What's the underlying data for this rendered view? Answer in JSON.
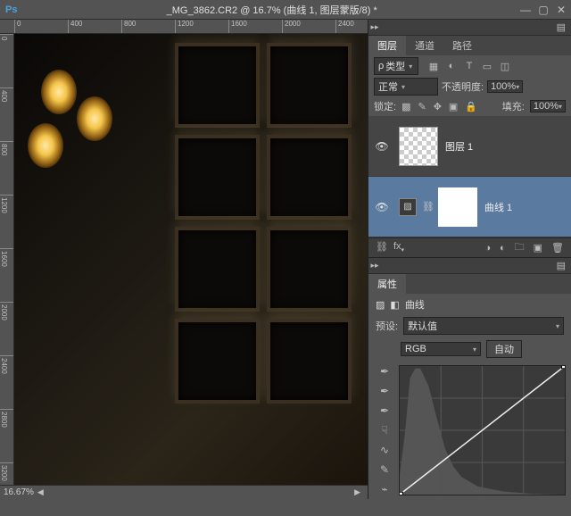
{
  "title": "_MG_3862.CR2 @ 16.7% (曲线 1, 图层蒙版/8) *",
  "ruler_h": [
    "0",
    "400",
    "800",
    "1200",
    "1600",
    "2000",
    "2400"
  ],
  "ruler_v": [
    "0",
    "400",
    "800",
    "1200",
    "1600",
    "2000",
    "2400",
    "2800",
    "3200"
  ],
  "status": {
    "zoom": "16.67%"
  },
  "layers_panel": {
    "tabs": [
      {
        "label": "图层",
        "active": true
      },
      {
        "label": "通道",
        "active": false
      },
      {
        "label": "路径",
        "active": false
      }
    ],
    "kind_label": "类型",
    "blend_mode": "正常",
    "opacity_label": "不透明度:",
    "opacity_value": "100%",
    "lock_label": "锁定:",
    "fill_label": "填充:",
    "fill_value": "100%",
    "layers": [
      {
        "name": "图层 1",
        "type": "raster",
        "visible": true,
        "active": false
      },
      {
        "name": "曲线 1",
        "type": "adjustment",
        "visible": true,
        "active": true
      }
    ]
  },
  "properties_panel": {
    "title": "属性",
    "adj_label": "曲线",
    "preset_label": "预设:",
    "preset_value": "默认值",
    "channel": "RGB",
    "auto_label": "自动"
  },
  "chart_data": {
    "type": "line",
    "title": "曲线",
    "xlabel": "",
    "ylabel": "",
    "xlim": [
      0,
      255
    ],
    "ylim": [
      0,
      255
    ],
    "series": [
      {
        "name": "curve",
        "x": [
          0,
          255
        ],
        "y": [
          0,
          255
        ]
      }
    ],
    "histogram": {
      "x": [
        0,
        8,
        16,
        24,
        32,
        40,
        48,
        56,
        64,
        72,
        80,
        96,
        128,
        160,
        192,
        224,
        255
      ],
      "y": [
        40,
        120,
        230,
        250,
        250,
        210,
        150,
        90,
        55,
        35,
        22,
        12,
        6,
        3,
        1,
        0,
        0
      ]
    }
  }
}
